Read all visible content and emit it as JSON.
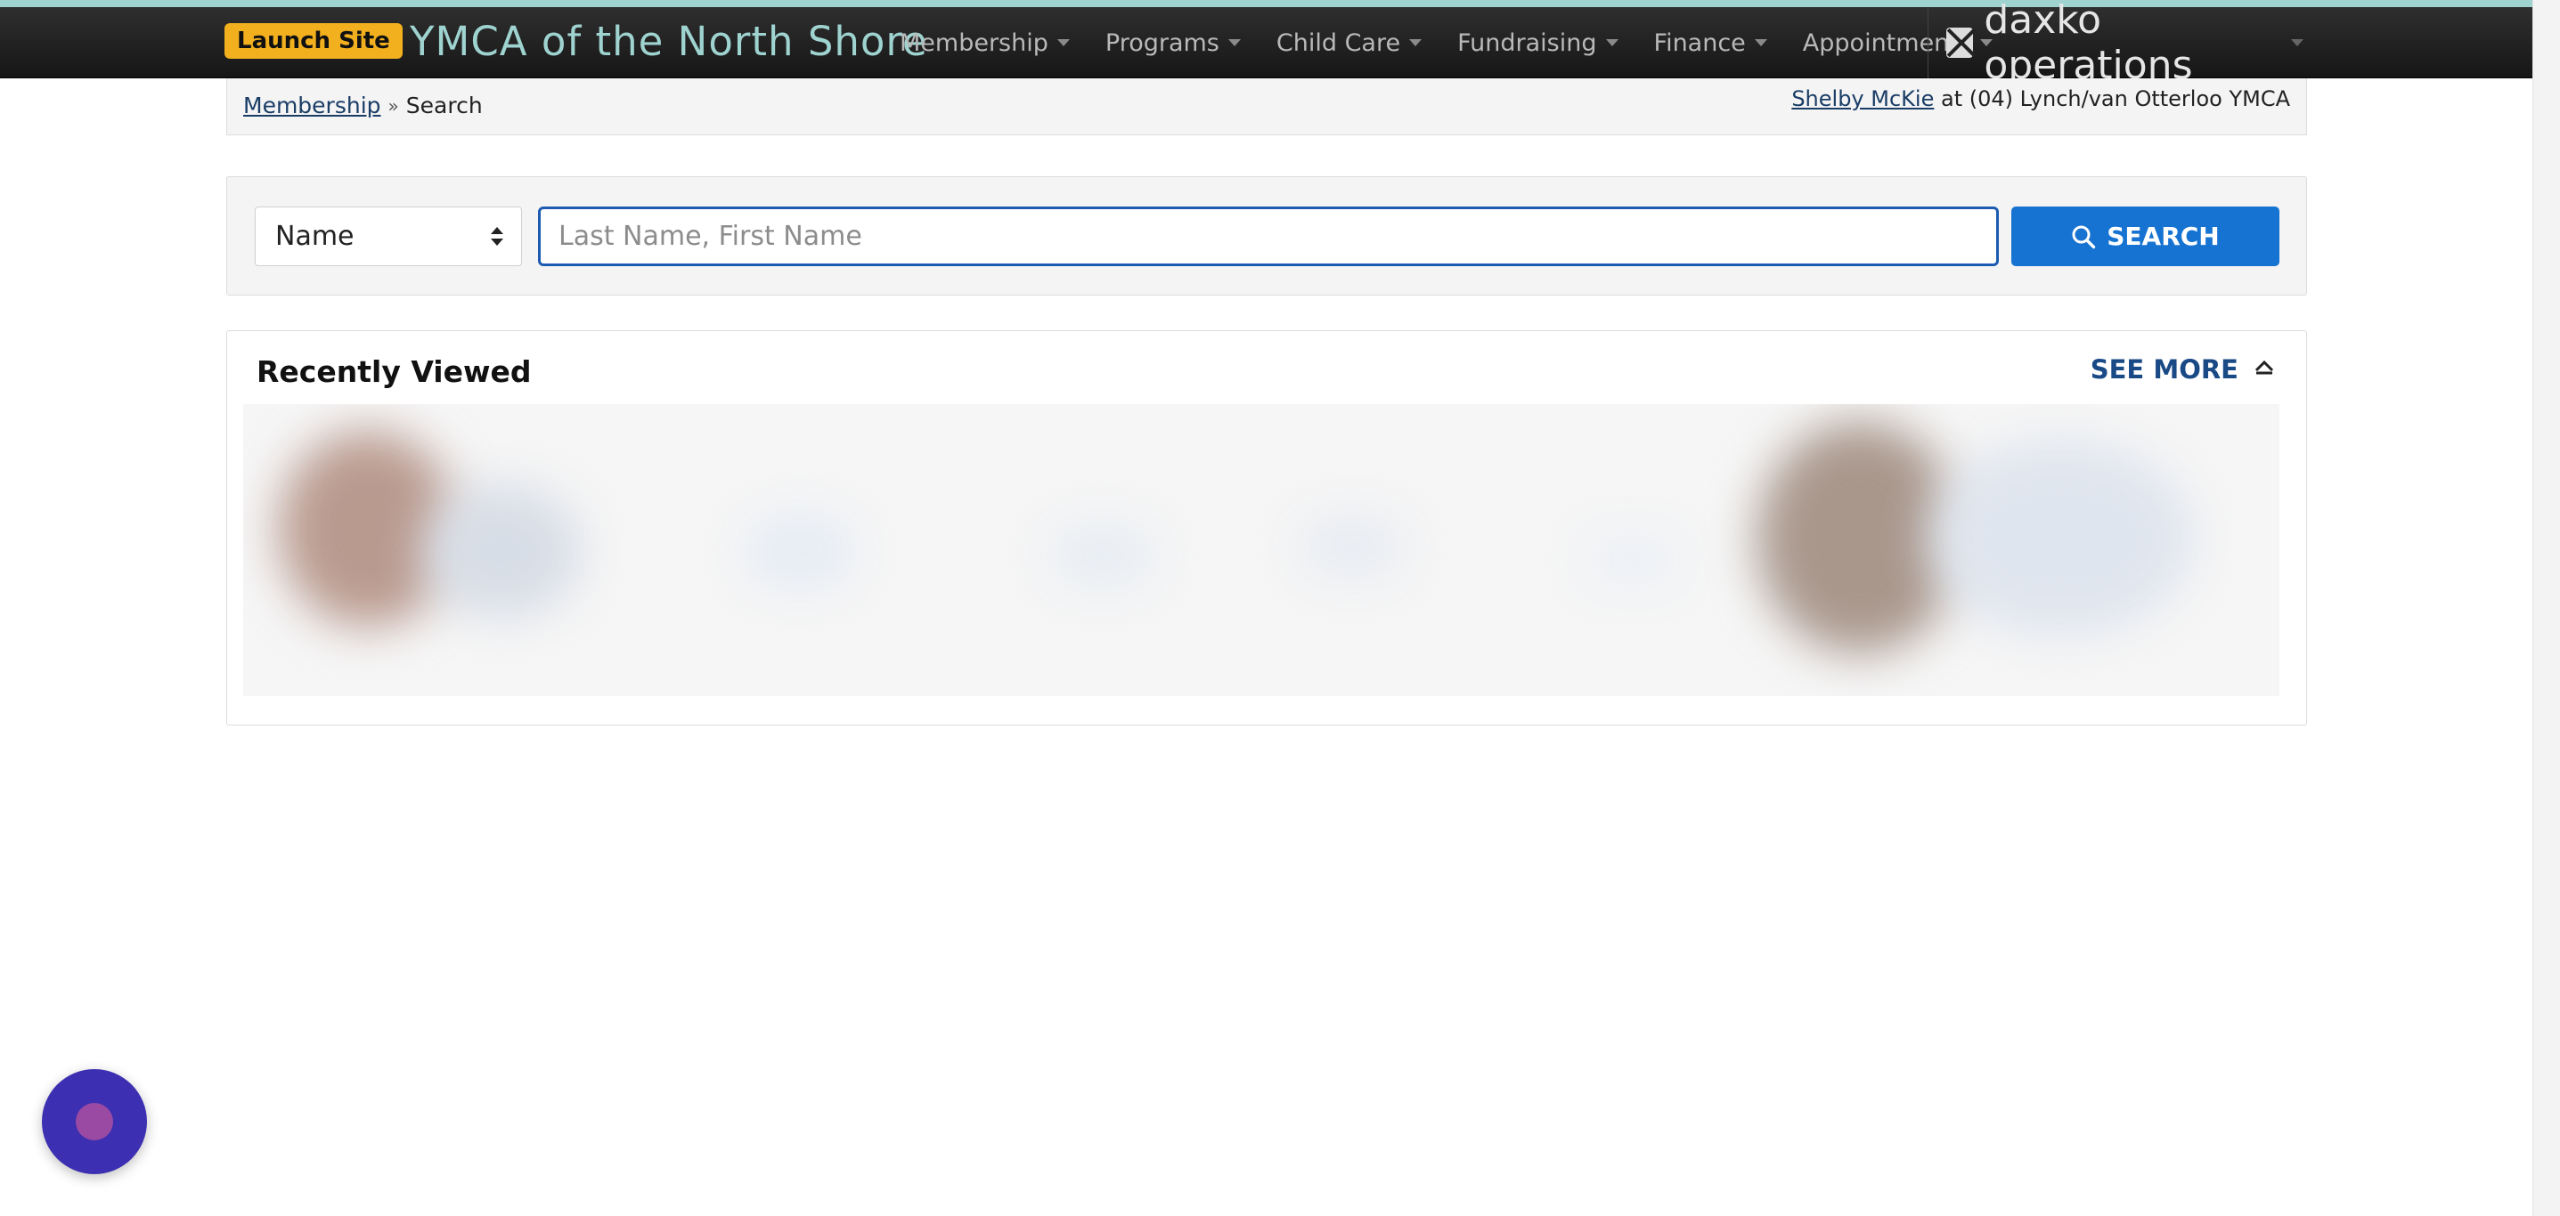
{
  "header": {
    "launch_label": "Launch Site",
    "brand": "YMCA of the North Shore",
    "nav": [
      {
        "label": "Membership"
      },
      {
        "label": "Programs"
      },
      {
        "label": "Child Care"
      },
      {
        "label": "Fundraising"
      },
      {
        "label": "Finance"
      },
      {
        "label": "Appointments"
      }
    ],
    "product": "daxko operations",
    "accent_color": "#9ed3d0",
    "launch_color": "#f2b01e"
  },
  "breadcrumb": {
    "parent": "Membership",
    "separator": "»",
    "current": "Search"
  },
  "user": {
    "name": "Shelby McKie",
    "location_text": "at (04) Lynch/van Otterloo YMCA"
  },
  "search": {
    "type_selected": "Name",
    "placeholder": "Last Name, First Name",
    "value": "",
    "button_label": "SEARCH",
    "button_color": "#1673d1"
  },
  "recent": {
    "title": "Recently Viewed",
    "see_more_label": "SEE MORE",
    "collapse_icon": "chevron-up-icon"
  },
  "chat": {
    "icon": "chat-bubble-icon",
    "color": "#3c2fb1"
  }
}
